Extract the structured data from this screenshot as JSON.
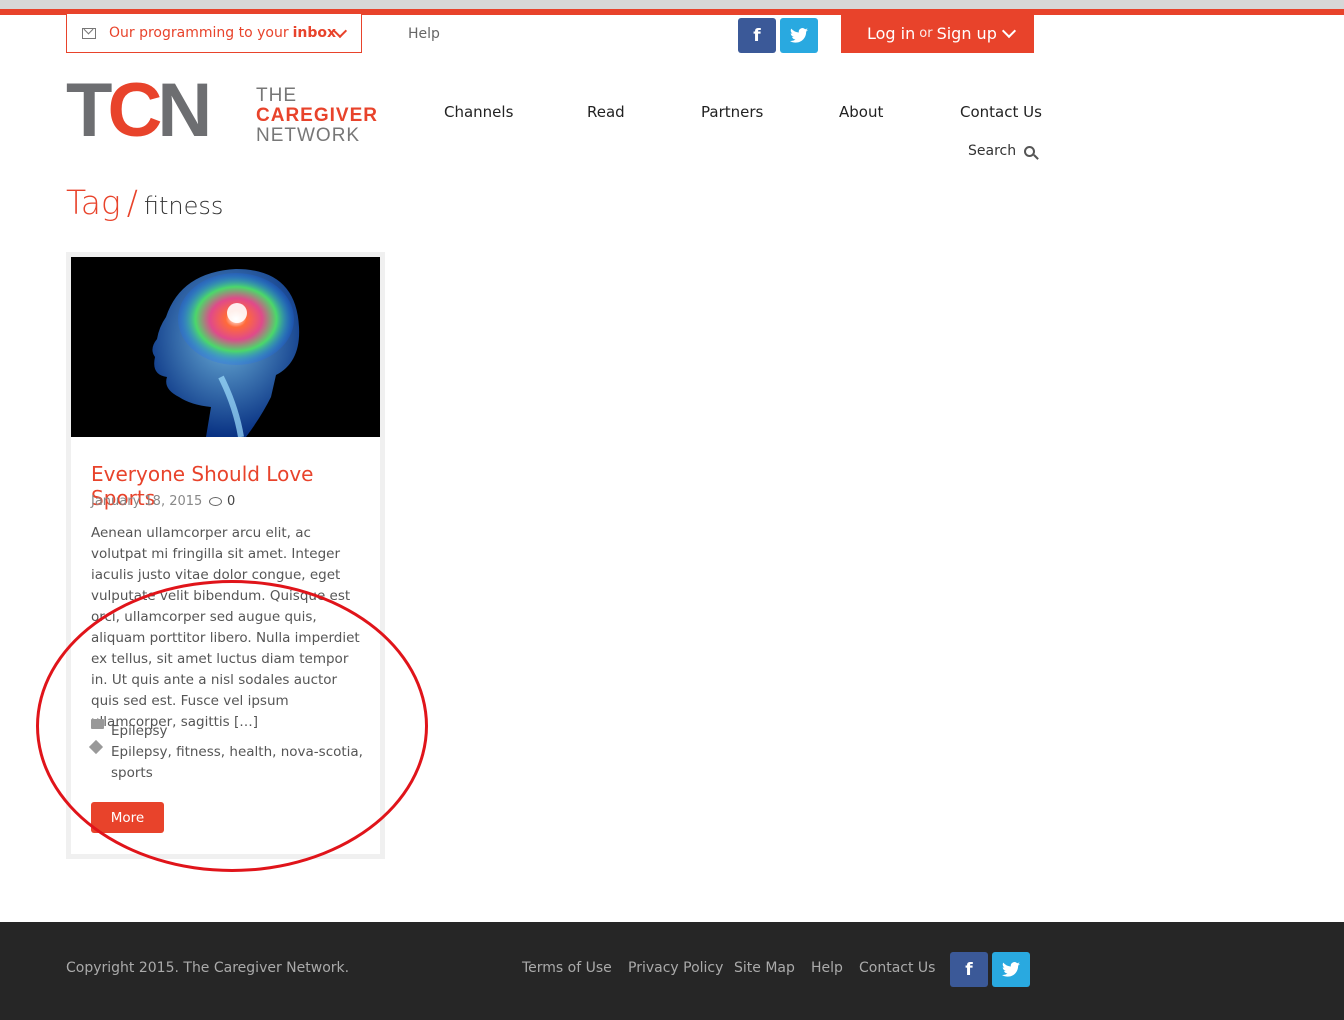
{
  "topbar": {
    "inbox_prefix": "Our programming to your",
    "inbox_bold": "inbox",
    "help": "Help",
    "social": {
      "facebook": "f",
      "twitter": "t"
    },
    "login": {
      "login": "Log in",
      "or": "or",
      "signup": "Sign up"
    }
  },
  "logo": {
    "tcn_part1": "TC",
    "tcn_part2": "N",
    "line1": "THE",
    "line2": "CAREGIVER",
    "line3": "NETWORK"
  },
  "nav": {
    "items": [
      "Channels",
      "Read",
      "Partners",
      "About",
      "Contact Us"
    ],
    "search": "Search"
  },
  "page": {
    "title_prefix": "Tag",
    "slash": "/",
    "tag": "fitness"
  },
  "post": {
    "title": "Everyone Should Love Sports",
    "date": "January 18, 2015",
    "comments": "0",
    "excerpt": "Aenean ullamcorper arcu elit, ac volutpat mi fringilla sit amet. Integer iaculis justo vitae dolor congue, eget vulputate velit bibendum. Quisque est orci, ullamcorper sed augue quis, aliquam porttitor libero. Nulla imperdiet ex tellus, sit amet luctus diam tempor in. Ut quis ante a nisl sodales auctor quis sed est. Fusce vel ipsum ullamcorper, sagittis […]",
    "category": "Epilepsy",
    "tags": "Epilepsy, fitness, health, nova-scotia, sports",
    "more": "More"
  },
  "footer": {
    "copyright": "Copyright 2015. The Caregiver Network.",
    "links": [
      "Terms of Use",
      "Privacy Policy",
      "Site Map",
      "Help",
      "Contact Us"
    ]
  },
  "colors": {
    "brand": "#e8432b",
    "facebook": "#3b5998",
    "twitter": "#29a9e0",
    "footer_bg": "#262626"
  }
}
